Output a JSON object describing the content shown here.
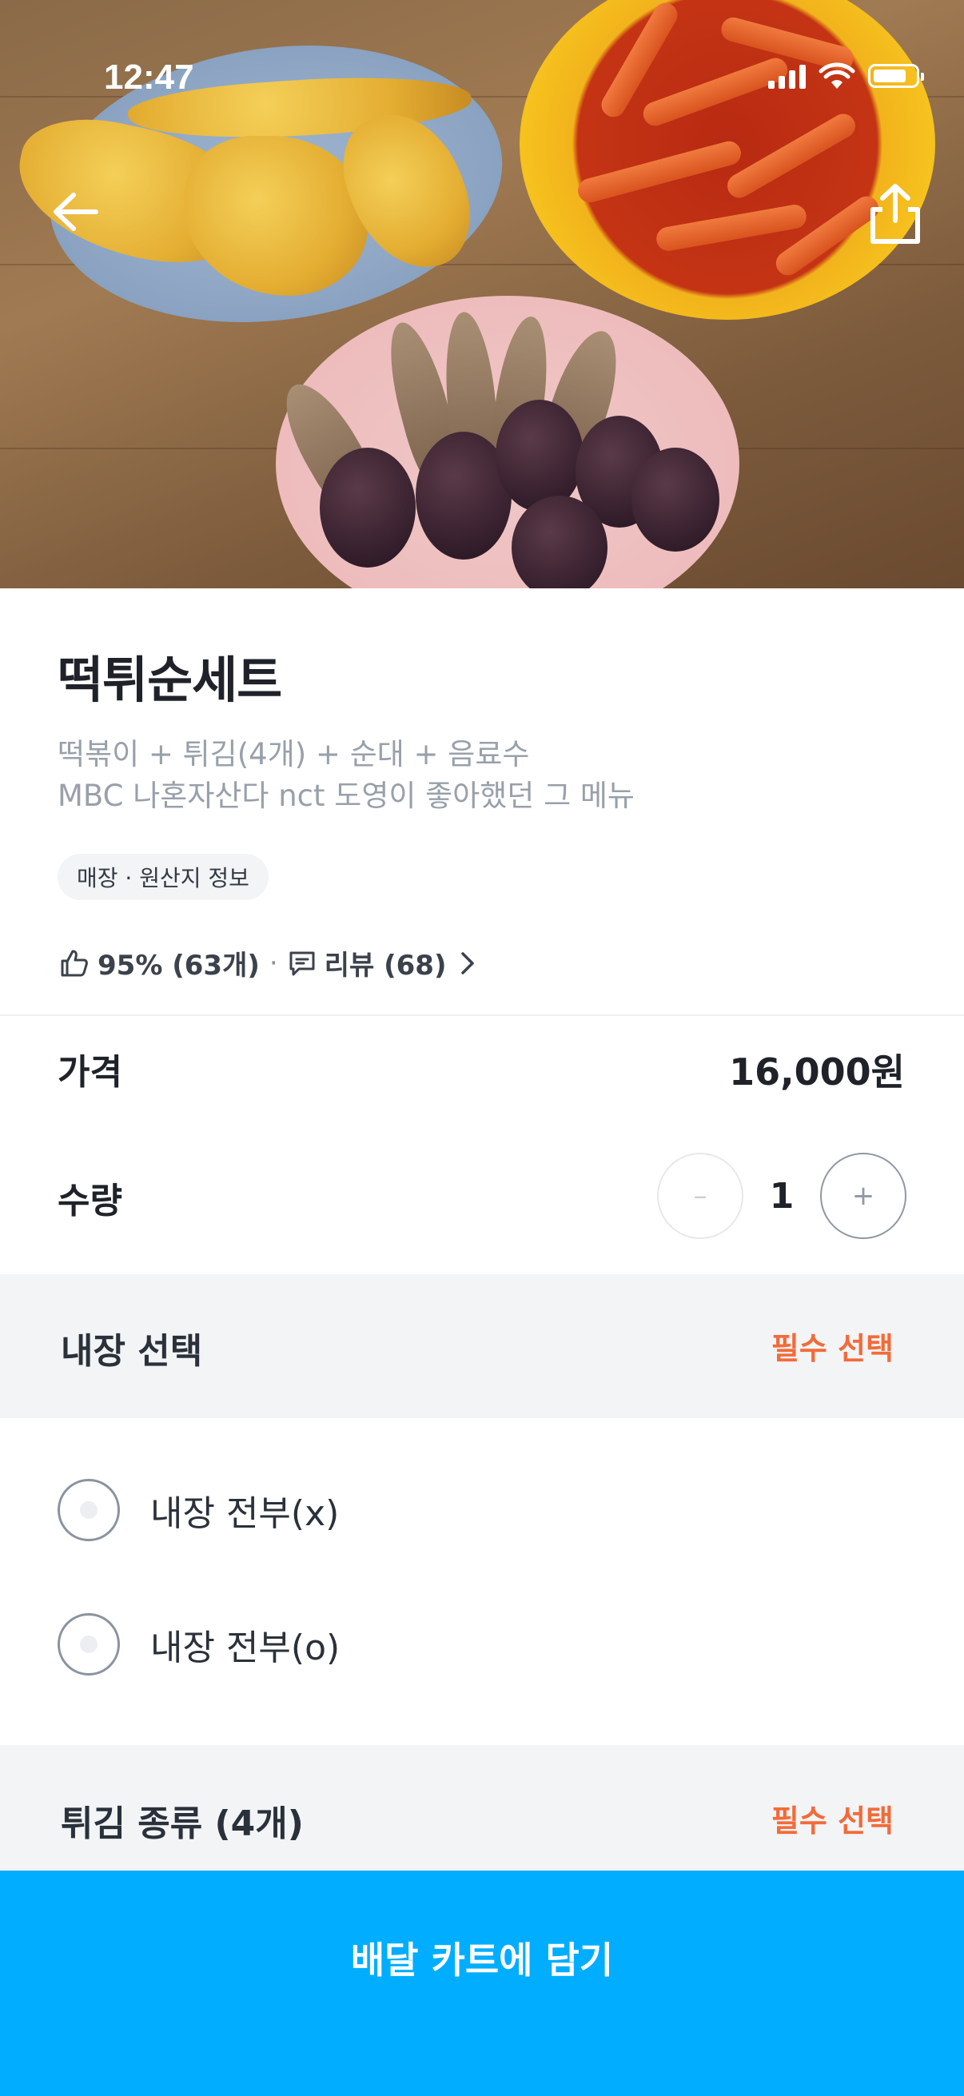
{
  "status_bar": {
    "time": "12:47"
  },
  "hero": {
    "alt": "떡튀순세트 food photo"
  },
  "product": {
    "title": "떡튀순세트",
    "description_line1": "떡볶이 + 튀김(4개) + 순대 + 음료수",
    "description_line2": "MBC 나혼자산다 nct 도영이 좋아했던 그 메뉴",
    "chip_label": "매장 · 원산지 정보",
    "rating_percent": "95% (63개)",
    "rating_separator": "·",
    "review_label": "리뷰 (68)"
  },
  "price": {
    "label": "가격",
    "value": "16,000원"
  },
  "quantity": {
    "label": "수량",
    "value": "1",
    "minus": "–",
    "plus": "+"
  },
  "sections": [
    {
      "title": "내장 선택",
      "required": "필수 선택",
      "options": [
        {
          "label": "내장 전부(x)"
        },
        {
          "label": "내장 전부(o)"
        }
      ]
    },
    {
      "title": "튀김 종류 (4개)",
      "required": "필수 선택"
    }
  ],
  "cta": {
    "label": "배달 카트에 담기"
  },
  "colors": {
    "accent": "#00adff",
    "required": "#f26b3a",
    "section_bg": "#f2f4f6"
  }
}
